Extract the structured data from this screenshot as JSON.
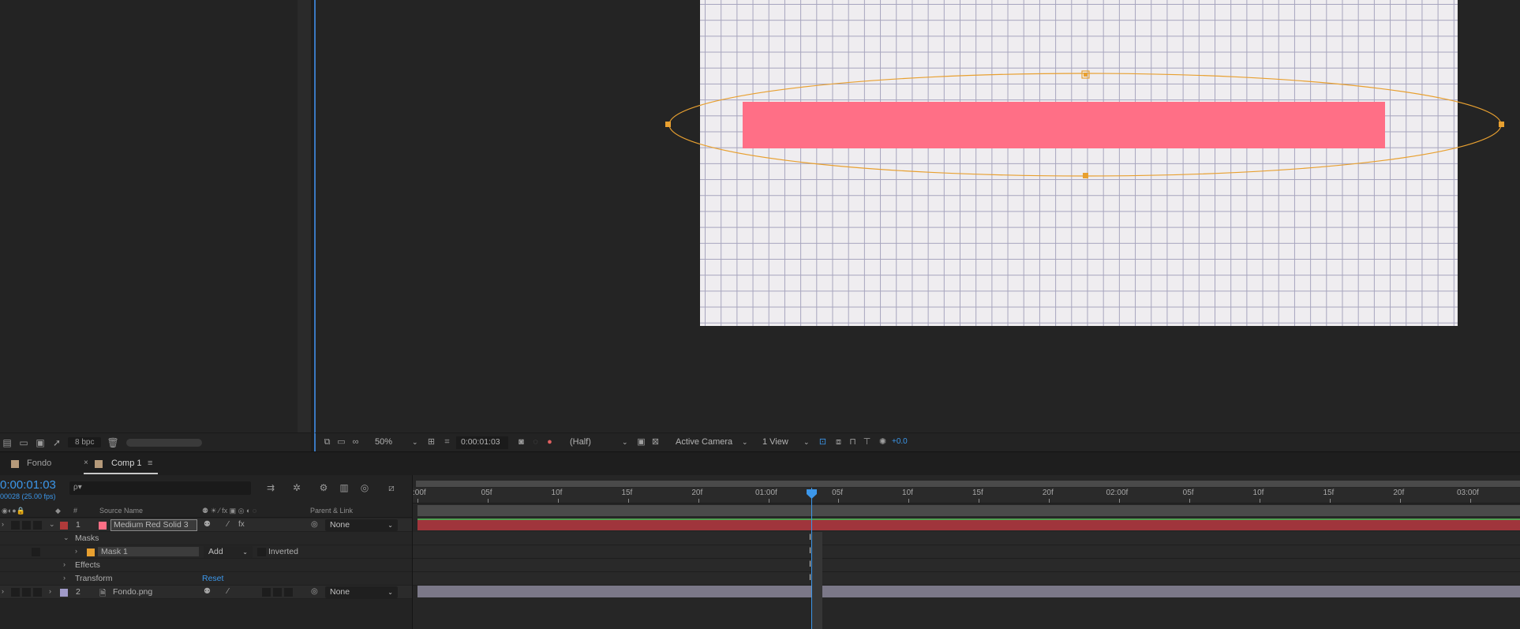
{
  "project": {
    "bpc": "8 bpc",
    "footer_icons": [
      "interpret-footage-icon",
      "new-folder-icon",
      "new-comp-icon",
      "render-queue-icon",
      "trash-icon"
    ]
  },
  "viewer": {
    "zoom": "50%",
    "timecode": "0:00:01:03",
    "resolution": "(Half)",
    "camera": "Active Camera",
    "views": "1 View",
    "exposure": "+0.0",
    "colors": {
      "solid": "#ff6f86",
      "mask": "#e8a030",
      "canvas": "#efedf0"
    }
  },
  "tabs": [
    {
      "label": "Fondo",
      "swatch": "#b59a7a"
    },
    {
      "label": "Comp 1",
      "swatch": "#b59a7a",
      "active": true
    }
  ],
  "timeline": {
    "timecode": "0:00:01:03",
    "frames_fps": "00028 (25.00 fps)",
    "search_icon": "ρ▾",
    "columns": {
      "num": "#",
      "source_name": "Source Name",
      "parent": "Parent & Link"
    },
    "layers": [
      {
        "num": "1",
        "name": "Medium Red Solid 3",
        "parent": "None",
        "label_color": "#b03a3a",
        "swatch": "#ff6f86"
      },
      {
        "num": "2",
        "name": "Fondo.png",
        "parent": "None",
        "label_color": "#a09ac8"
      }
    ],
    "sub_rows": {
      "masks": "Masks",
      "mask1": "Mask 1",
      "mask_mode": "Add",
      "inverted": "Inverted",
      "effects": "Effects",
      "transform": "Transform",
      "reset": "Reset"
    },
    "ruler": [
      ":00f",
      "05f",
      "10f",
      "15f",
      "20f",
      "01:00f",
      "05f",
      "10f",
      "15f",
      "20f",
      "02:00f",
      "05f",
      "10f",
      "15f",
      "20f",
      "03:00f"
    ]
  }
}
